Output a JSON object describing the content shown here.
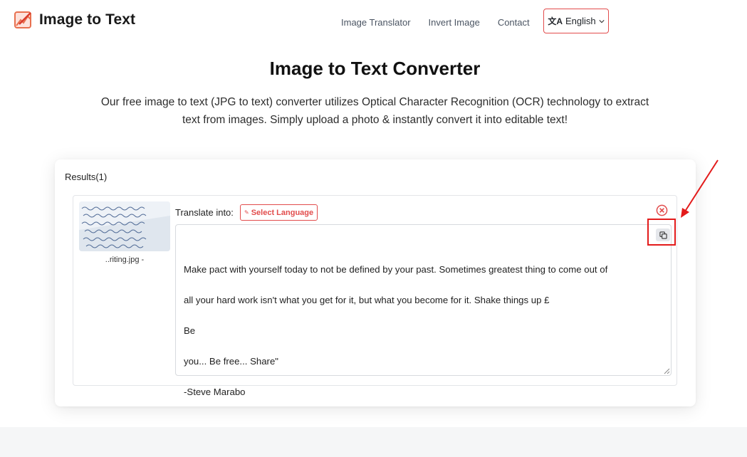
{
  "header": {
    "logo_text": "Image to Text",
    "nav": [
      "Image Translator",
      "Invert Image",
      "Contact"
    ],
    "language": "English"
  },
  "hero": {
    "title": "Image to Text Converter",
    "description_line1": "Our free image to text (JPG to text) converter utilizes Optical Character Recognition (OCR) technology to extract",
    "description_line2": "text from images. Simply upload a photo & instantly convert it into editable text!"
  },
  "results": {
    "label": "Results(1)",
    "item": {
      "file_name": "..riting.jpg -",
      "translate_label": "Translate into:",
      "select_language": "Select Language",
      "text_lines": [
        "Make pact with yourself today to not be defined by your past. Sometimes greatest thing to come out of",
        "all your hard work isn't what you get for it, but what you become for it. Shake things up £",
        "Be",
        "you... Be free... Share\"",
        "-Steve Marabo"
      ]
    }
  },
  "colors": {
    "accent": "#e24c4c",
    "annotation": "#e31b1b"
  }
}
